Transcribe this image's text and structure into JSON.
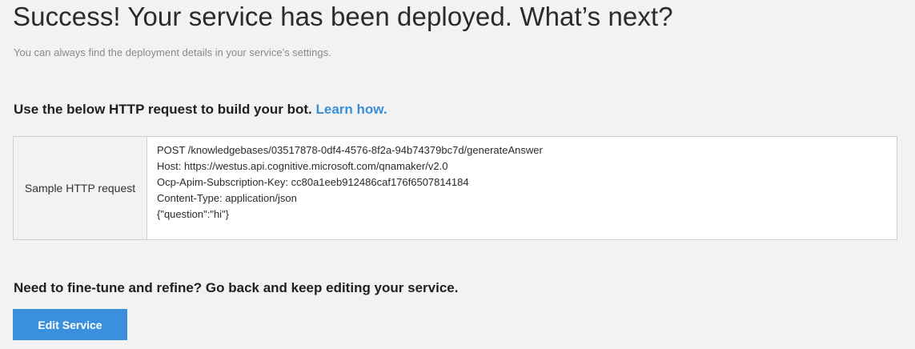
{
  "header": {
    "title": "Success! Your service has been deployed. What’s next?",
    "subtitle": "You can always find the deployment details in your service’s settings."
  },
  "http_section": {
    "heading": "Use the below HTTP request to build your bot.",
    "learn_link": "Learn how.",
    "request_label": "Sample HTTP request",
    "request_lines": [
      "POST /knowledgebases/03517878-0df4-4576-8f2a-94b74379bc7d/generateAnswer",
      "Host: https://westus.api.cognitive.microsoft.com/qnamaker/v2.0",
      "Ocp-Apim-Subscription-Key: cc80a1eeb912486caf176f6507814184",
      "Content-Type: application/json",
      "{\"question\":\"hi\"}"
    ]
  },
  "edit_section": {
    "heading": "Need to fine-tune and refine? Go back and keep editing your service.",
    "button_label": "Edit Service"
  },
  "colors": {
    "background": "#f2f2f2",
    "accent": "#3a90dc",
    "link": "#3a8fd6"
  }
}
